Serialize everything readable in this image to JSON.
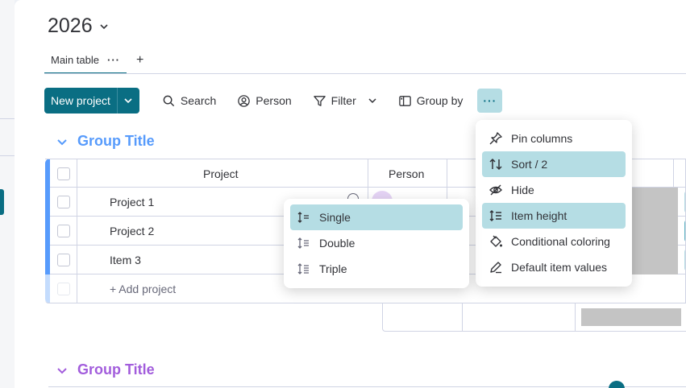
{
  "board": {
    "title": "2026"
  },
  "tabs": {
    "main_table_label": "Main table",
    "main_table_more": "···",
    "add_label": "+"
  },
  "toolbar": {
    "new_project_label": "New project",
    "search_label": "Search",
    "person_label": "Person",
    "filter_label": "Filter",
    "group_by_label": "Group by",
    "more_label": "···"
  },
  "groups": [
    {
      "title": "Group Title",
      "color": "#579bfc"
    },
    {
      "title": "Group Title",
      "color": "#a25ddc"
    }
  ],
  "table": {
    "columns": [
      "Project",
      "Person"
    ],
    "rows": [
      {
        "name": "Project 1"
      },
      {
        "name": "Project 2"
      },
      {
        "name": "Item 3"
      }
    ],
    "add_row_label": "+ Add project"
  },
  "more_menu": {
    "items": [
      {
        "label": "Pin columns",
        "icon": "pin-icon",
        "selected": false
      },
      {
        "label": "Sort / 2",
        "icon": "sort-icon",
        "selected": true
      },
      {
        "label": "Hide",
        "icon": "eye-slash-icon",
        "selected": false
      },
      {
        "label": "Item height",
        "icon": "row-height-icon",
        "selected": true
      },
      {
        "label": "Conditional coloring",
        "icon": "paint-bucket-icon",
        "selected": false
      },
      {
        "label": "Default item values",
        "icon": "pencil-icon",
        "selected": false
      }
    ]
  },
  "height_submenu": {
    "items": [
      {
        "label": "Single",
        "selected": true
      },
      {
        "label": "Double",
        "selected": false
      },
      {
        "label": "Triple",
        "selected": false
      }
    ]
  },
  "colors": {
    "accent": "#0a6e83",
    "selected_bg": "#b5dde4",
    "placeholder_gray": "#c4c4c4"
  }
}
